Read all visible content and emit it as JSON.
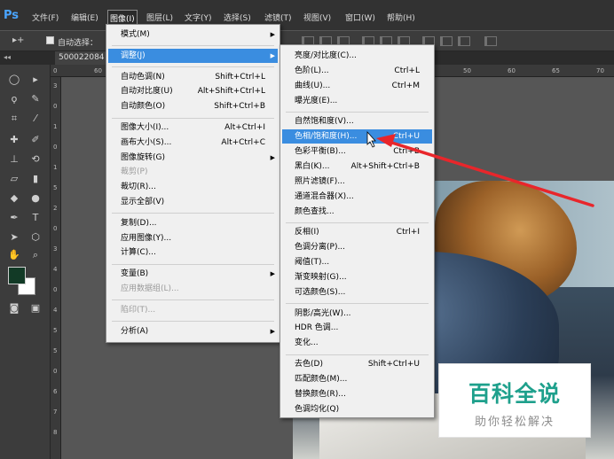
{
  "app": {
    "logo": "Ps"
  },
  "menubar": {
    "items": [
      "文件(F)",
      "编辑(E)",
      "图像(I)",
      "图层(L)",
      "文字(Y)",
      "选择(S)",
      "滤镜(T)",
      "视图(V)",
      "窗口(W)",
      "帮助(H)"
    ],
    "active_index": 2
  },
  "options_bar": {
    "tool_symbol": "▸+",
    "auto_select_label": "自动选择：",
    "auto_select_checked": true
  },
  "document": {
    "tab_label": "500022084"
  },
  "rulers": {
    "h_ticks": [
      "0",
      "60",
      "50",
      "60",
      "65",
      "70"
    ],
    "v_ticks": [
      "3",
      "0",
      "1",
      "0",
      "1",
      "5",
      "2",
      "0",
      "3",
      "4",
      "0",
      "4",
      "5",
      "5",
      "0",
      "6",
      "7",
      "8"
    ]
  },
  "image_menu": {
    "items": [
      {
        "label": "模式(M)",
        "shortcut": "",
        "submenu": true,
        "disabled": false,
        "highlighted": false
      },
      {
        "sep": true
      },
      {
        "label": "调整(J)",
        "shortcut": "",
        "submenu": true,
        "disabled": false,
        "highlighted": true
      },
      {
        "sep": true
      },
      {
        "label": "自动色调(N)",
        "shortcut": "Shift+Ctrl+L",
        "submenu": false,
        "disabled": false,
        "highlighted": false
      },
      {
        "label": "自动对比度(U)",
        "shortcut": "Alt+Shift+Ctrl+L",
        "submenu": false,
        "disabled": false,
        "highlighted": false
      },
      {
        "label": "自动颜色(O)",
        "shortcut": "Shift+Ctrl+B",
        "submenu": false,
        "disabled": false,
        "highlighted": false
      },
      {
        "sep": true
      },
      {
        "label": "图像大小(I)...",
        "shortcut": "Alt+Ctrl+I",
        "submenu": false,
        "disabled": false,
        "highlighted": false
      },
      {
        "label": "画布大小(S)...",
        "shortcut": "Alt+Ctrl+C",
        "submenu": false,
        "disabled": false,
        "highlighted": false
      },
      {
        "label": "图像旋转(G)",
        "shortcut": "",
        "submenu": true,
        "disabled": false,
        "highlighted": false
      },
      {
        "label": "裁剪(P)",
        "shortcut": "",
        "submenu": false,
        "disabled": true,
        "highlighted": false
      },
      {
        "label": "裁切(R)...",
        "shortcut": "",
        "submenu": false,
        "disabled": false,
        "highlighted": false
      },
      {
        "label": "显示全部(V)",
        "shortcut": "",
        "submenu": false,
        "disabled": false,
        "highlighted": false
      },
      {
        "sep": true
      },
      {
        "label": "复制(D)...",
        "shortcut": "",
        "submenu": false,
        "disabled": false,
        "highlighted": false
      },
      {
        "label": "应用图像(Y)...",
        "shortcut": "",
        "submenu": false,
        "disabled": false,
        "highlighted": false
      },
      {
        "label": "计算(C)...",
        "shortcut": "",
        "submenu": false,
        "disabled": false,
        "highlighted": false
      },
      {
        "sep": true
      },
      {
        "label": "变量(B)",
        "shortcut": "",
        "submenu": true,
        "disabled": false,
        "highlighted": false
      },
      {
        "label": "应用数据组(L)...",
        "shortcut": "",
        "submenu": false,
        "disabled": true,
        "highlighted": false
      },
      {
        "sep": true
      },
      {
        "label": "陷印(T)...",
        "shortcut": "",
        "submenu": false,
        "disabled": true,
        "highlighted": false
      },
      {
        "sep": true
      },
      {
        "label": "分析(A)",
        "shortcut": "",
        "submenu": true,
        "disabled": false,
        "highlighted": false
      }
    ]
  },
  "adjust_menu": {
    "items": [
      {
        "label": "亮度/对比度(C)...",
        "shortcut": "",
        "highlighted": false
      },
      {
        "label": "色阶(L)...",
        "shortcut": "Ctrl+L",
        "highlighted": false
      },
      {
        "label": "曲线(U)...",
        "shortcut": "Ctrl+M",
        "highlighted": false
      },
      {
        "label": "曝光度(E)...",
        "shortcut": "",
        "highlighted": false
      },
      {
        "sep": true
      },
      {
        "label": "自然饱和度(V)...",
        "shortcut": "",
        "highlighted": false
      },
      {
        "label": "色相/饱和度(H)...",
        "shortcut": "Ctrl+U",
        "highlighted": true
      },
      {
        "label": "色彩平衡(B)...",
        "shortcut": "Ctrl+B",
        "highlighted": false
      },
      {
        "label": "黑白(K)...",
        "shortcut": "Alt+Shift+Ctrl+B",
        "highlighted": false
      },
      {
        "label": "照片滤镜(F)...",
        "shortcut": "",
        "highlighted": false
      },
      {
        "label": "通道混合器(X)...",
        "shortcut": "",
        "highlighted": false
      },
      {
        "label": "颜色查找...",
        "shortcut": "",
        "highlighted": false
      },
      {
        "sep": true
      },
      {
        "label": "反相(I)",
        "shortcut": "Ctrl+I",
        "highlighted": false
      },
      {
        "label": "色调分离(P)...",
        "shortcut": "",
        "highlighted": false
      },
      {
        "label": "阈值(T)...",
        "shortcut": "",
        "highlighted": false
      },
      {
        "label": "渐变映射(G)...",
        "shortcut": "",
        "highlighted": false
      },
      {
        "label": "可选颜色(S)...",
        "shortcut": "",
        "highlighted": false
      },
      {
        "sep": true
      },
      {
        "label": "阴影/高光(W)...",
        "shortcut": "",
        "highlighted": false
      },
      {
        "label": "HDR 色调...",
        "shortcut": "",
        "highlighted": false
      },
      {
        "label": "变化...",
        "shortcut": "",
        "highlighted": false
      },
      {
        "sep": true
      },
      {
        "label": "去色(D)",
        "shortcut": "Shift+Ctrl+U",
        "highlighted": false
      },
      {
        "label": "匹配颜色(M)...",
        "shortcut": "",
        "highlighted": false
      },
      {
        "label": "替换颜色(R)...",
        "shortcut": "",
        "highlighted": false
      },
      {
        "label": "色调均化(Q)",
        "shortcut": "",
        "highlighted": false
      }
    ]
  },
  "colors": {
    "foreground": "#123a26",
    "background": "#ffffff",
    "highlight": "#3a8de0",
    "annotation_arrow": "#e8262b",
    "watermark_green": "#1ea08c"
  },
  "watermark": {
    "title": "百科全说",
    "subtitle": "助你轻松解决"
  }
}
